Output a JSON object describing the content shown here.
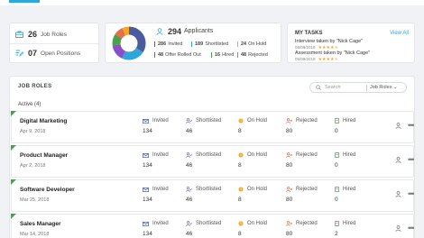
{
  "colors": {
    "accent": "#2fa6d9",
    "invited": "#4c5a9e",
    "shortlisted": "#6b6bd6",
    "onhold": "#f5a623",
    "rejected": "#e86e4a",
    "hired": "#4aa14a"
  },
  "summary": {
    "job_roles_count": "26",
    "job_roles_label": "Job Roles",
    "open_positions_count": "07",
    "open_positions_label": "Open Positions"
  },
  "applicants": {
    "count": "294",
    "label": "Applicants",
    "legend": [
      {
        "value": "286",
        "label": "Invited"
      },
      {
        "value": "189",
        "label": "Shortlisted"
      },
      {
        "value": "24",
        "label": "On Hold"
      },
      {
        "value": "48",
        "label": "Offer Rolled Out"
      },
      {
        "value": "16",
        "label": "Hired"
      },
      {
        "value": "48",
        "label": "Rejected"
      }
    ]
  },
  "tasks": {
    "title": "MY TASKS",
    "view_all": "View All",
    "items": [
      {
        "text": "Interview taken by \"Nick Cage\"",
        "date": "05/08/2018",
        "rating": 4
      },
      {
        "text": "Assessment taken by \"Nick Cage\"",
        "date": "05/08/2018",
        "rating": 4
      }
    ]
  },
  "job_roles": {
    "title": "JOB ROLES",
    "search_placeholder": "Search",
    "search_scope": "Job Roles",
    "active_label": "Active (4)",
    "columns": {
      "invited": "Invited",
      "shortlisted": "Shortlisted",
      "onhold": "On Hold",
      "rejected": "Rejected",
      "hired": "Hired"
    },
    "rows": [
      {
        "title": "Digital Marketing",
        "date": "Apr 9, 2018",
        "invited": "134",
        "shortlisted": "46",
        "onhold": "8",
        "rejected": "80",
        "hired": "0"
      },
      {
        "title": "Product Manager",
        "date": "Apr 2, 2018",
        "invited": "134",
        "shortlisted": "46",
        "onhold": "8",
        "rejected": "80",
        "hired": "0"
      },
      {
        "title": "Software Developer",
        "date": "Mar 25, 2018",
        "invited": "134",
        "shortlisted": "46",
        "onhold": "8",
        "rejected": "80",
        "hired": "0"
      },
      {
        "title": "Sales Manager",
        "date": "Mar 14, 2018",
        "invited": "134",
        "shortlisted": "46",
        "onhold": "8",
        "rejected": "80",
        "hired": "2"
      }
    ]
  },
  "more_icon_text": "•••"
}
